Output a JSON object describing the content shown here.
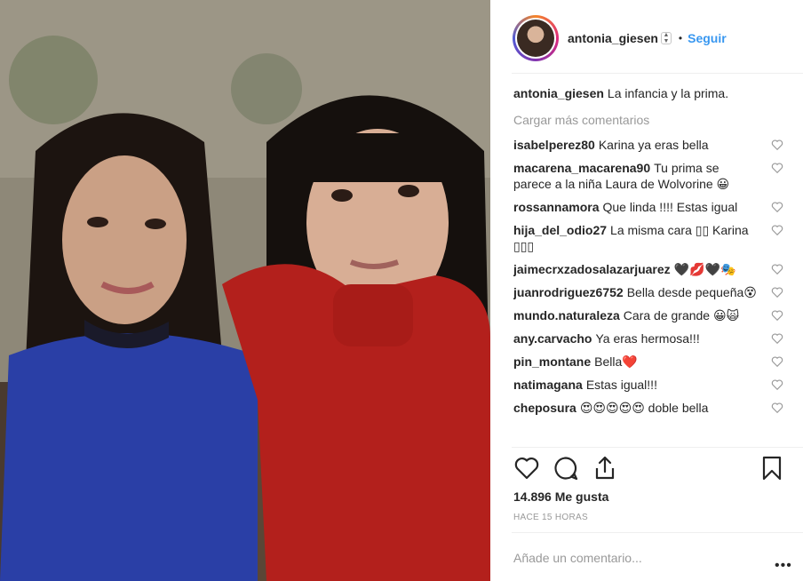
{
  "post": {
    "username": "antonia_giesen",
    "follow_label": "Seguir",
    "separator": "•",
    "caption_text": "La infancia y la prima.",
    "load_more": "Cargar más comentarios",
    "likes": "14.896 Me gusta",
    "time": "HACE 15 HORAS",
    "add_comment_placeholder": "Añade un comentario...",
    "more_label": "•••"
  },
  "comments": [
    {
      "user": "isabelperez80",
      "text": "Karina ya eras bella"
    },
    {
      "user": "macarena_macarena90",
      "text": "Tu prima se parece a la niña Laura de Wolvorine 😀"
    },
    {
      "user": "rossannamora",
      "text": "Que linda !!!! Estas igual"
    },
    {
      "user": "hija_del_odio27",
      "text": "La misma cara ▯▯ Karina ▯▯▯"
    },
    {
      "user": "jaimecrxzadosalazarjuarez",
      "text": "🖤💋🖤🎭"
    },
    {
      "user": "juanrodriguez6752",
      "text": "Bella desde pequeña😵"
    },
    {
      "user": "mundo.naturaleza",
      "text": "Cara de grande 😀🙀"
    },
    {
      "user": "any.carvacho",
      "text": "Ya eras hermosa!!!"
    },
    {
      "user": "pin_montane",
      "text": "Bella❤️"
    },
    {
      "user": "natimagana",
      "text": "Estas igual!!!"
    },
    {
      "user": "cheposura",
      "text": "😍😍😍😍😍 doble bella"
    }
  ],
  "colors": {
    "accent": "#3897f0",
    "muted": "#999999",
    "text": "#262626"
  }
}
